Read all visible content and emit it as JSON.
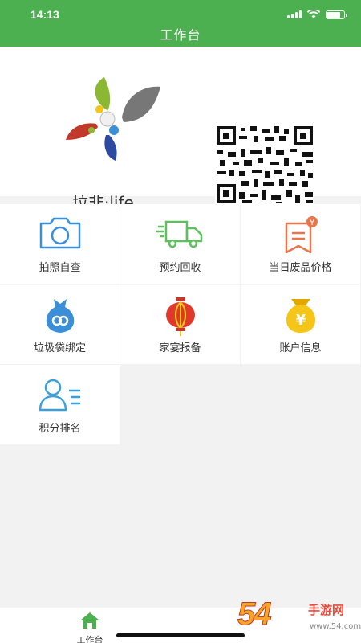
{
  "status_bar": {
    "time": "14:13"
  },
  "header": {
    "title": "工作台"
  },
  "banner": {
    "logo_text": "垃非·life"
  },
  "grid": {
    "items": [
      {
        "label": "拍照自查",
        "icon": "camera-icon"
      },
      {
        "label": "预约回收",
        "icon": "truck-icon"
      },
      {
        "label": "当日废品价格",
        "icon": "price-tag-icon"
      },
      {
        "label": "垃圾袋绑定",
        "icon": "bag-link-icon"
      },
      {
        "label": "家宴报备",
        "icon": "lantern-icon"
      },
      {
        "label": "账户信息",
        "icon": "money-bag-icon"
      },
      {
        "label": "积分排名",
        "icon": "user-list-icon"
      }
    ]
  },
  "tabbar": {
    "items": [
      {
        "label": "工作台",
        "icon": "home-icon",
        "active": true
      }
    ]
  },
  "watermark": {
    "main": "54",
    "side": "手游网",
    "url": "www.54.com.cn"
  },
  "colors": {
    "primary": "#4caf50",
    "camera_blue": "#3b8fd9",
    "price_orange": "#e8764a",
    "lantern_red": "#e0392b",
    "gold": "#f5c518"
  }
}
